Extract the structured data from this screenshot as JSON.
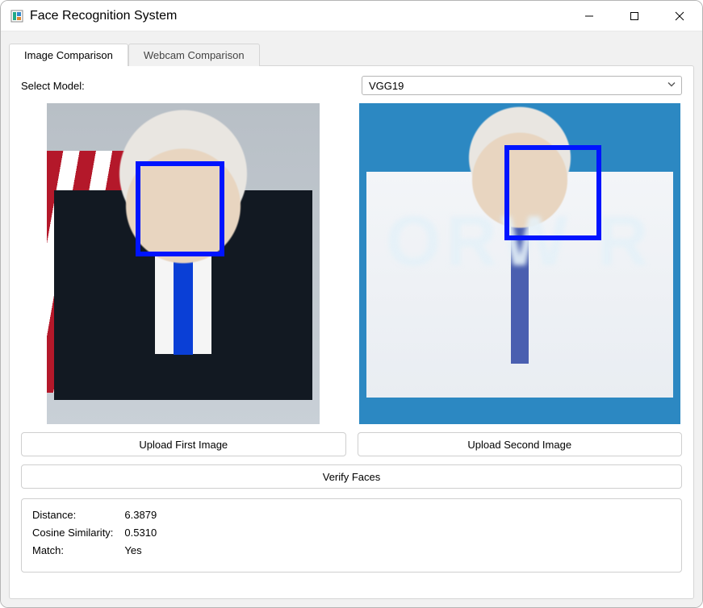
{
  "window": {
    "title": "Face Recognition System"
  },
  "tabs": {
    "image_comparison": "Image Comparison",
    "webcam_comparison": "Webcam Comparison"
  },
  "model": {
    "label": "Select Model:",
    "selected": "VGG19"
  },
  "buttons": {
    "upload_first": "Upload First Image",
    "upload_second": "Upload Second Image",
    "verify": "Verify Faces"
  },
  "results": {
    "distance_label": "Distance:",
    "distance_value": "6.3879",
    "cosine_label": "Cosine Similarity:",
    "cosine_value": "0.5310",
    "match_label": "Match:",
    "match_value": "Yes"
  }
}
